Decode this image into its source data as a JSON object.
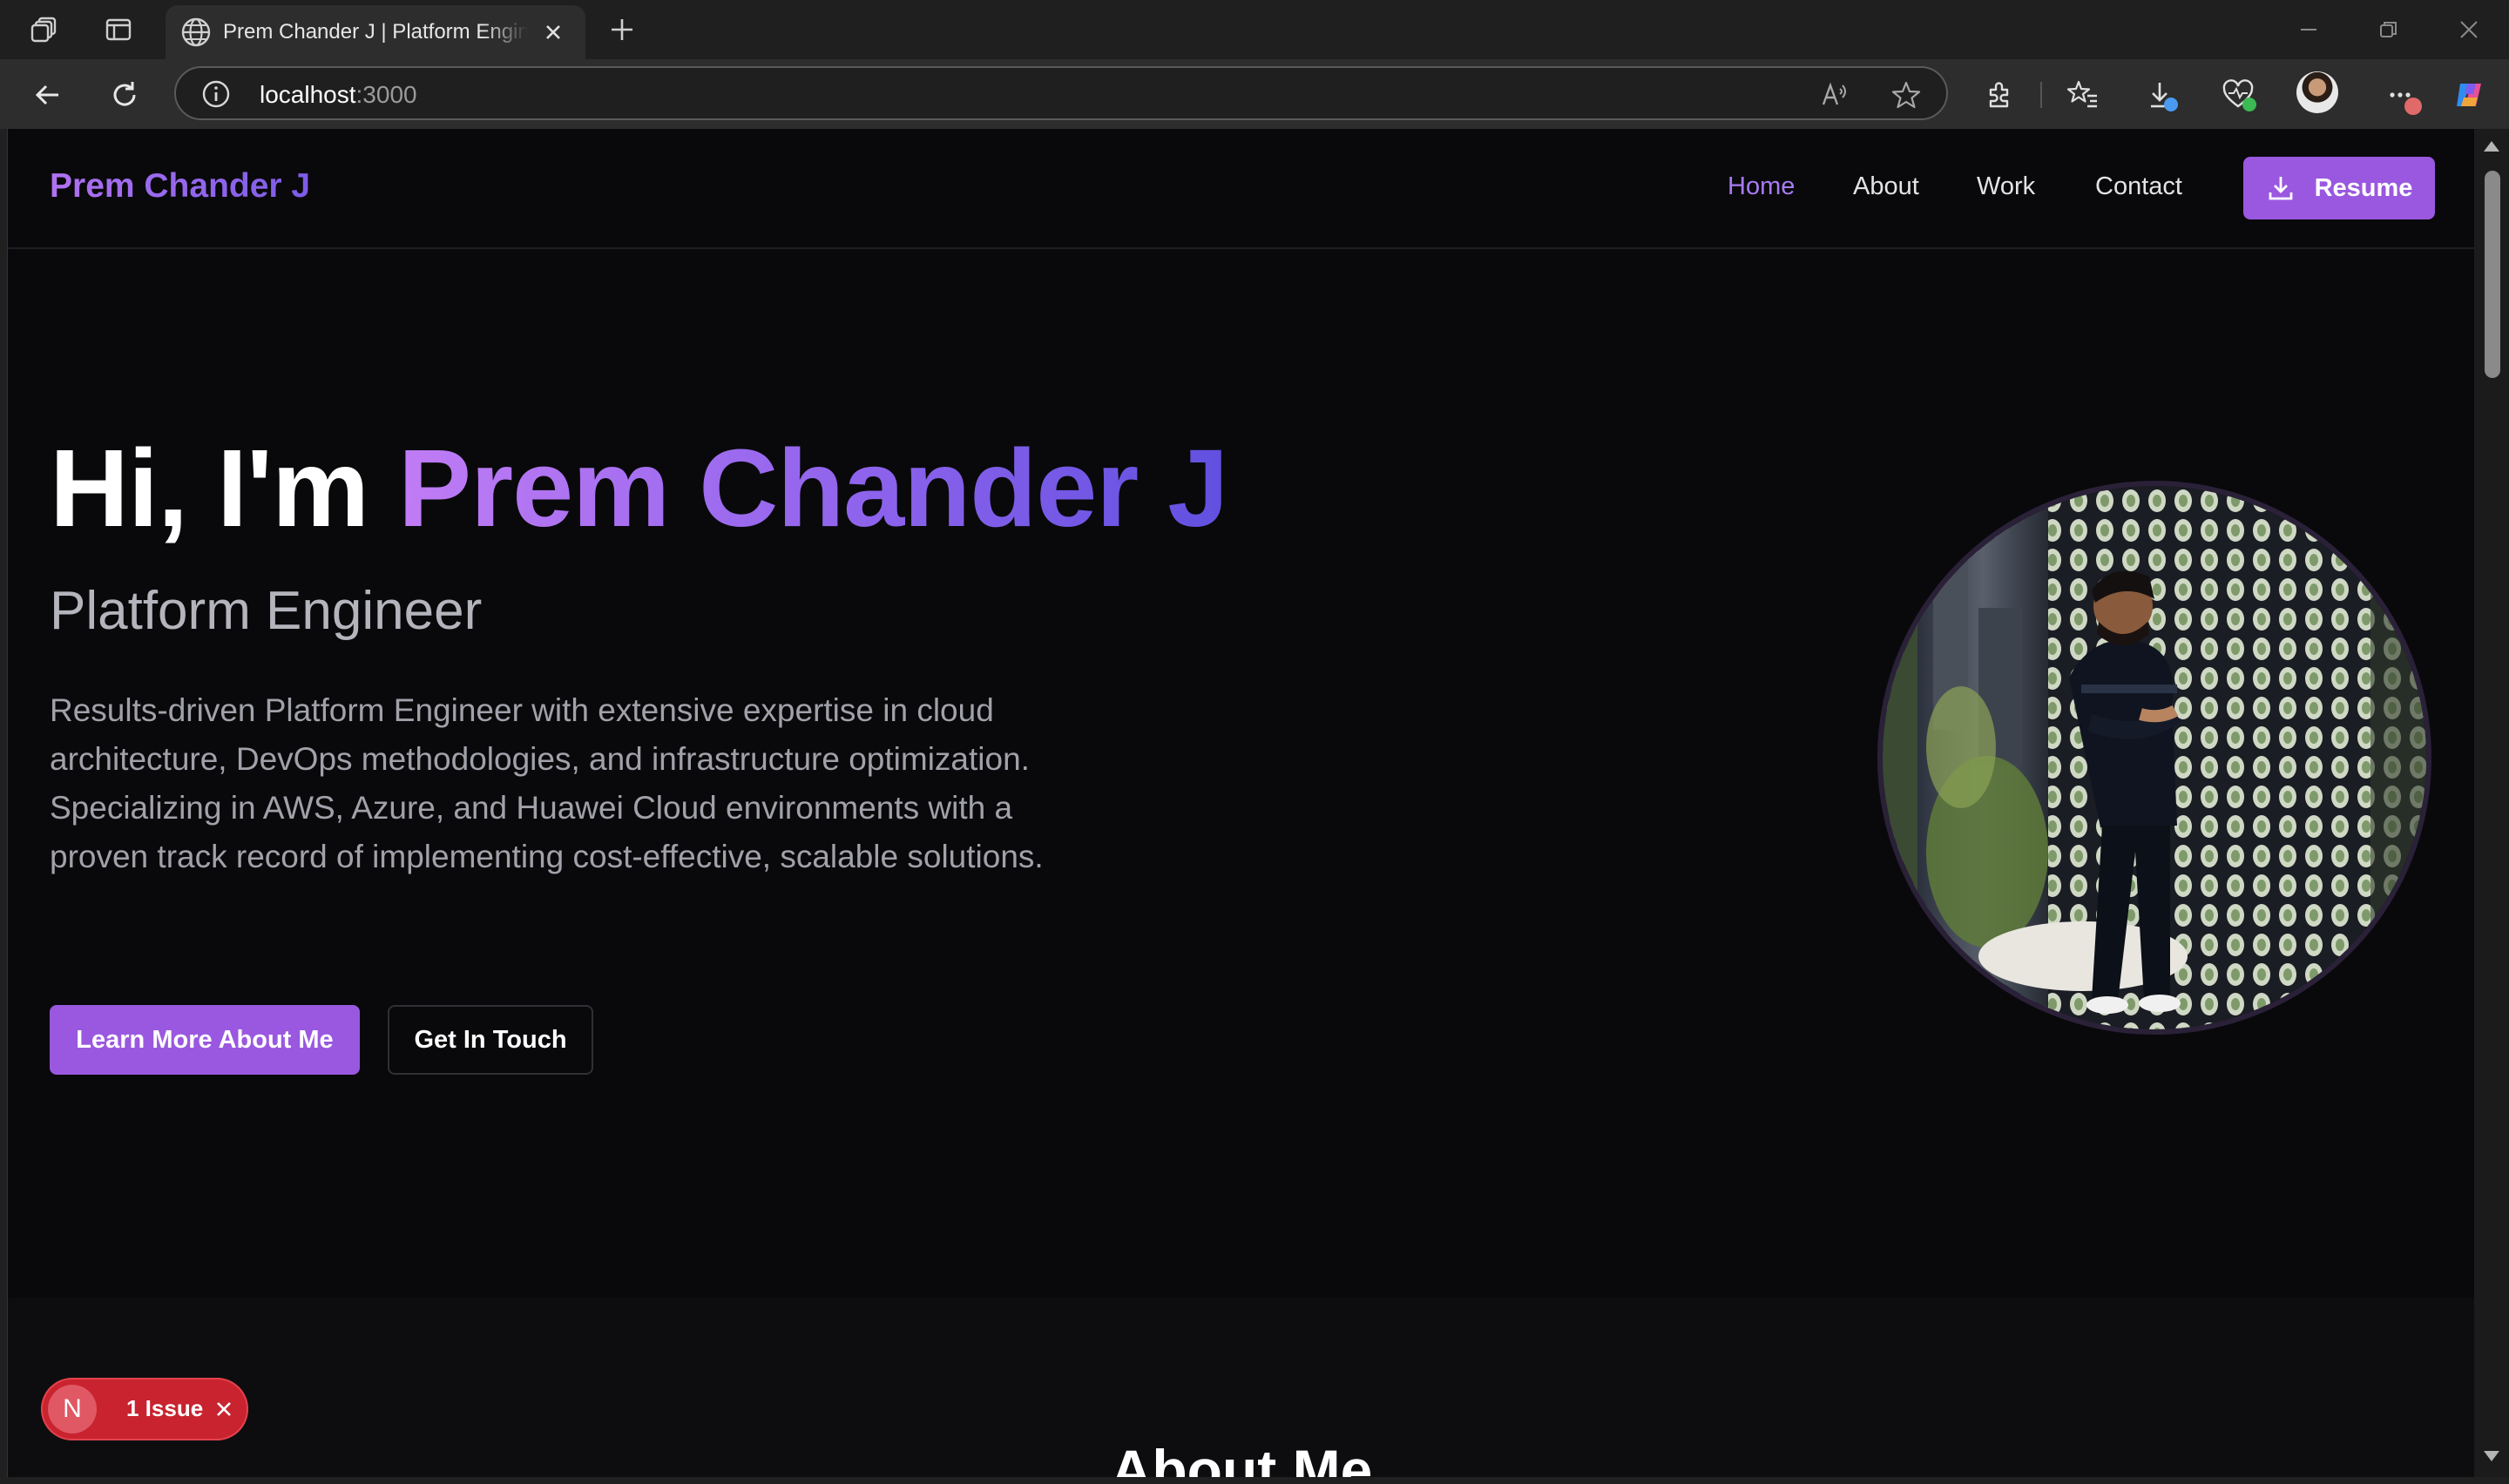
{
  "browser": {
    "tab_title": "Prem Chander J | Platform Engineer",
    "url_host": "localhost",
    "url_port": ":3000"
  },
  "nav": {
    "brand": "Prem Chander J",
    "links": [
      "Home",
      "About",
      "Work",
      "Contact"
    ],
    "active": "Home",
    "resume_label": "Resume"
  },
  "hero": {
    "greeting": "Hi, I'm ",
    "name": "Prem Chander J",
    "role": "Platform Engineer",
    "description": "Results-driven Platform Engineer with extensive expertise in cloud architecture, DevOps methodologies, and infrastructure optimization. Specializing in AWS, Azure, and Huawei Cloud environments with a proven track record of implementing cost-effective, scalable solutions.",
    "primary_button": "Learn More About Me",
    "secondary_button": "Get In Touch"
  },
  "about": {
    "title": "About Me"
  },
  "dev_overlay": {
    "logo_letter": "N",
    "issues_label": "1 Issue"
  },
  "colors": {
    "accent": "#9a58e0",
    "background": "#09090b",
    "issue_red": "#c8232f"
  }
}
